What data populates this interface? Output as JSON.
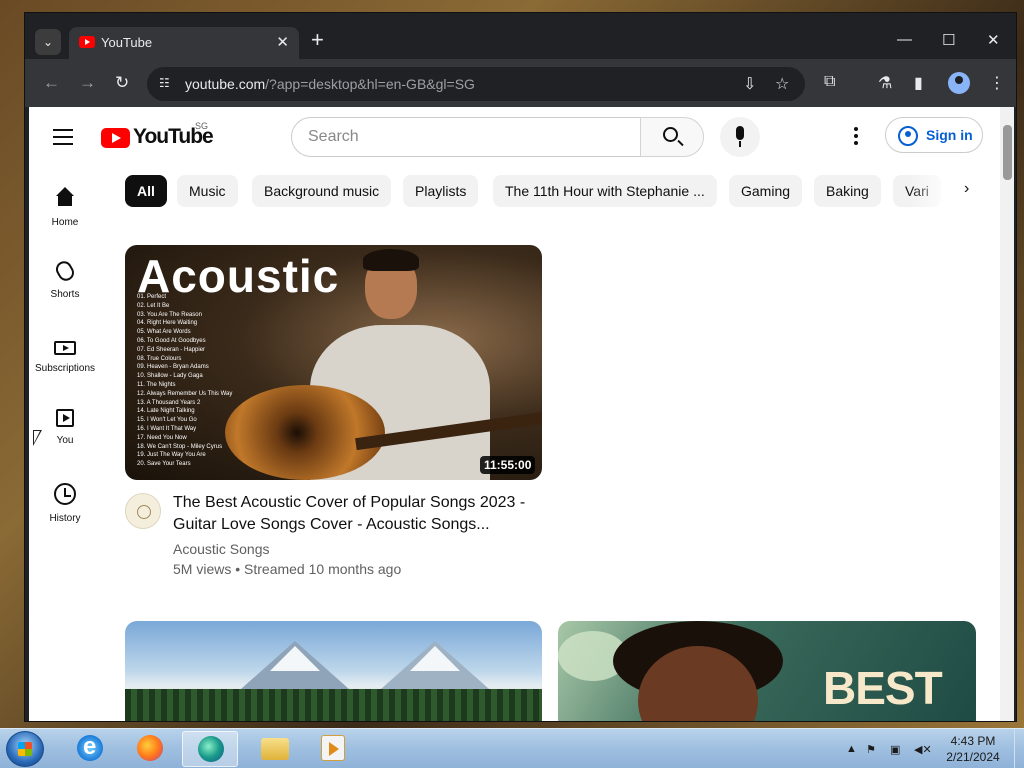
{
  "browser": {
    "tab_title": "YouTube",
    "url_host": "youtube.com",
    "url_rest": "/?app=desktop&hl=en-GB&gl=SG",
    "icons": [
      "tab-search-icon",
      "youtube-favicon",
      "close-icon",
      "plus-icon",
      "minimize-icon",
      "maximize-icon",
      "close-window-icon",
      "back-icon",
      "forward-icon",
      "reload-icon",
      "site-info-icon",
      "install-app-icon",
      "bookmark-star-icon",
      "extensions-icon",
      "labs-icon",
      "side-panel-icon",
      "profile-icon",
      "chrome-menu-icon"
    ]
  },
  "header": {
    "logo_text": "YouTube",
    "country_code": "SG",
    "search_placeholder": "Search",
    "signin_label": "Sign in"
  },
  "guide": {
    "items": [
      {
        "label": "Home",
        "icon": "home-icon"
      },
      {
        "label": "Shorts",
        "icon": "shorts-icon"
      },
      {
        "label": "Subscriptions",
        "icon": "subscriptions-icon"
      },
      {
        "label": "You",
        "icon": "you-icon"
      },
      {
        "label": "History",
        "icon": "history-icon"
      }
    ]
  },
  "chips": [
    "All",
    "Music",
    "Background music",
    "Playlists",
    "The 11th Hour with Stephanie ...",
    "Gaming",
    "Baking",
    "Vari"
  ],
  "videos": [
    {
      "thumb_title": "Acoustic",
      "tracklist": [
        "01. Perfect",
        "02. Let It Be",
        "03. You Are The Reason",
        "04. Right Here Waiting",
        "05. What Are Words",
        "06. To Good At Goodbyes",
        "07. Ed Sheeran - Happier",
        "08. True Colours",
        "09. Heaven - Bryan Adams",
        "10. Shallow - Lady Gaga",
        "11. The Nights",
        "12. Always Remember Us This Way",
        "13. A Thousand Years 2",
        "14. Late Night Talking",
        "15. I Won't Let You Go",
        "16. I Want It That Way",
        "17. Need You Now",
        "18. We Can't Stop - Miley Cyrus",
        "19. Just The Way You Are",
        "20. Save Your Tears"
      ],
      "duration": "11:55:00",
      "title": "The Best Acoustic Cover of Popular Songs 2023 - Guitar Love Songs Cover - Acoustic Songs...",
      "channel": "Acoustic Songs",
      "meta": "5M views • Streamed 10 months ago"
    },
    {
      "thumb_title": ""
    },
    {
      "thumb_title": "BEST"
    }
  ],
  "taskbar": {
    "time": "4:43 PM",
    "date": "2/21/2024",
    "apps": [
      "start-orb-icon",
      "internet-explorer-icon",
      "firefox-icon",
      "edge-icon",
      "file-explorer-icon",
      "media-player-icon"
    ]
  }
}
